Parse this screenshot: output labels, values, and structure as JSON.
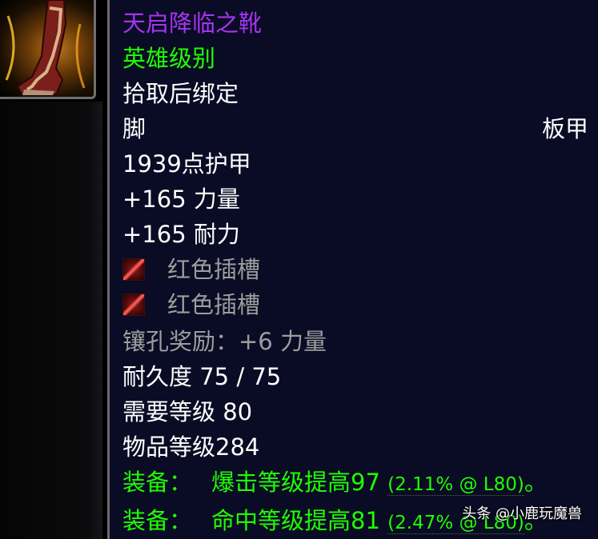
{
  "item": {
    "name": "天启降临之靴",
    "quality": "英雄级别",
    "bind": "拾取后绑定",
    "slot": "脚",
    "armor_type": "板甲",
    "armor": "1939点护甲",
    "stats": [
      "+165 力量",
      "+165 耐力"
    ],
    "sockets": [
      {
        "icon": "red-socket-icon",
        "label": "红色插槽"
      },
      {
        "icon": "red-socket-icon",
        "label": "红色插槽"
      }
    ],
    "socket_bonus": "镶孔奖励：+6 力量",
    "durability": "耐久度 75 / 75",
    "required_level": "需要等级 80",
    "item_level": "物品等级284",
    "equip_effects": [
      {
        "prefix": "装备：",
        "text": "爆击等级提高97",
        "detail": "(2.11% @ L80)",
        "suffix": "。"
      },
      {
        "prefix": "装备：",
        "text": "命中等级提高81",
        "detail": "(2.47% @ L80)",
        "suffix": "。"
      }
    ]
  },
  "watermark": "头条 @小鹿玩魔兽",
  "colors": {
    "epic": "#a335ee",
    "uncommon": "#1eff00",
    "inactive": "#9d9d9d",
    "tooltip_bg": "#0a0b24"
  }
}
